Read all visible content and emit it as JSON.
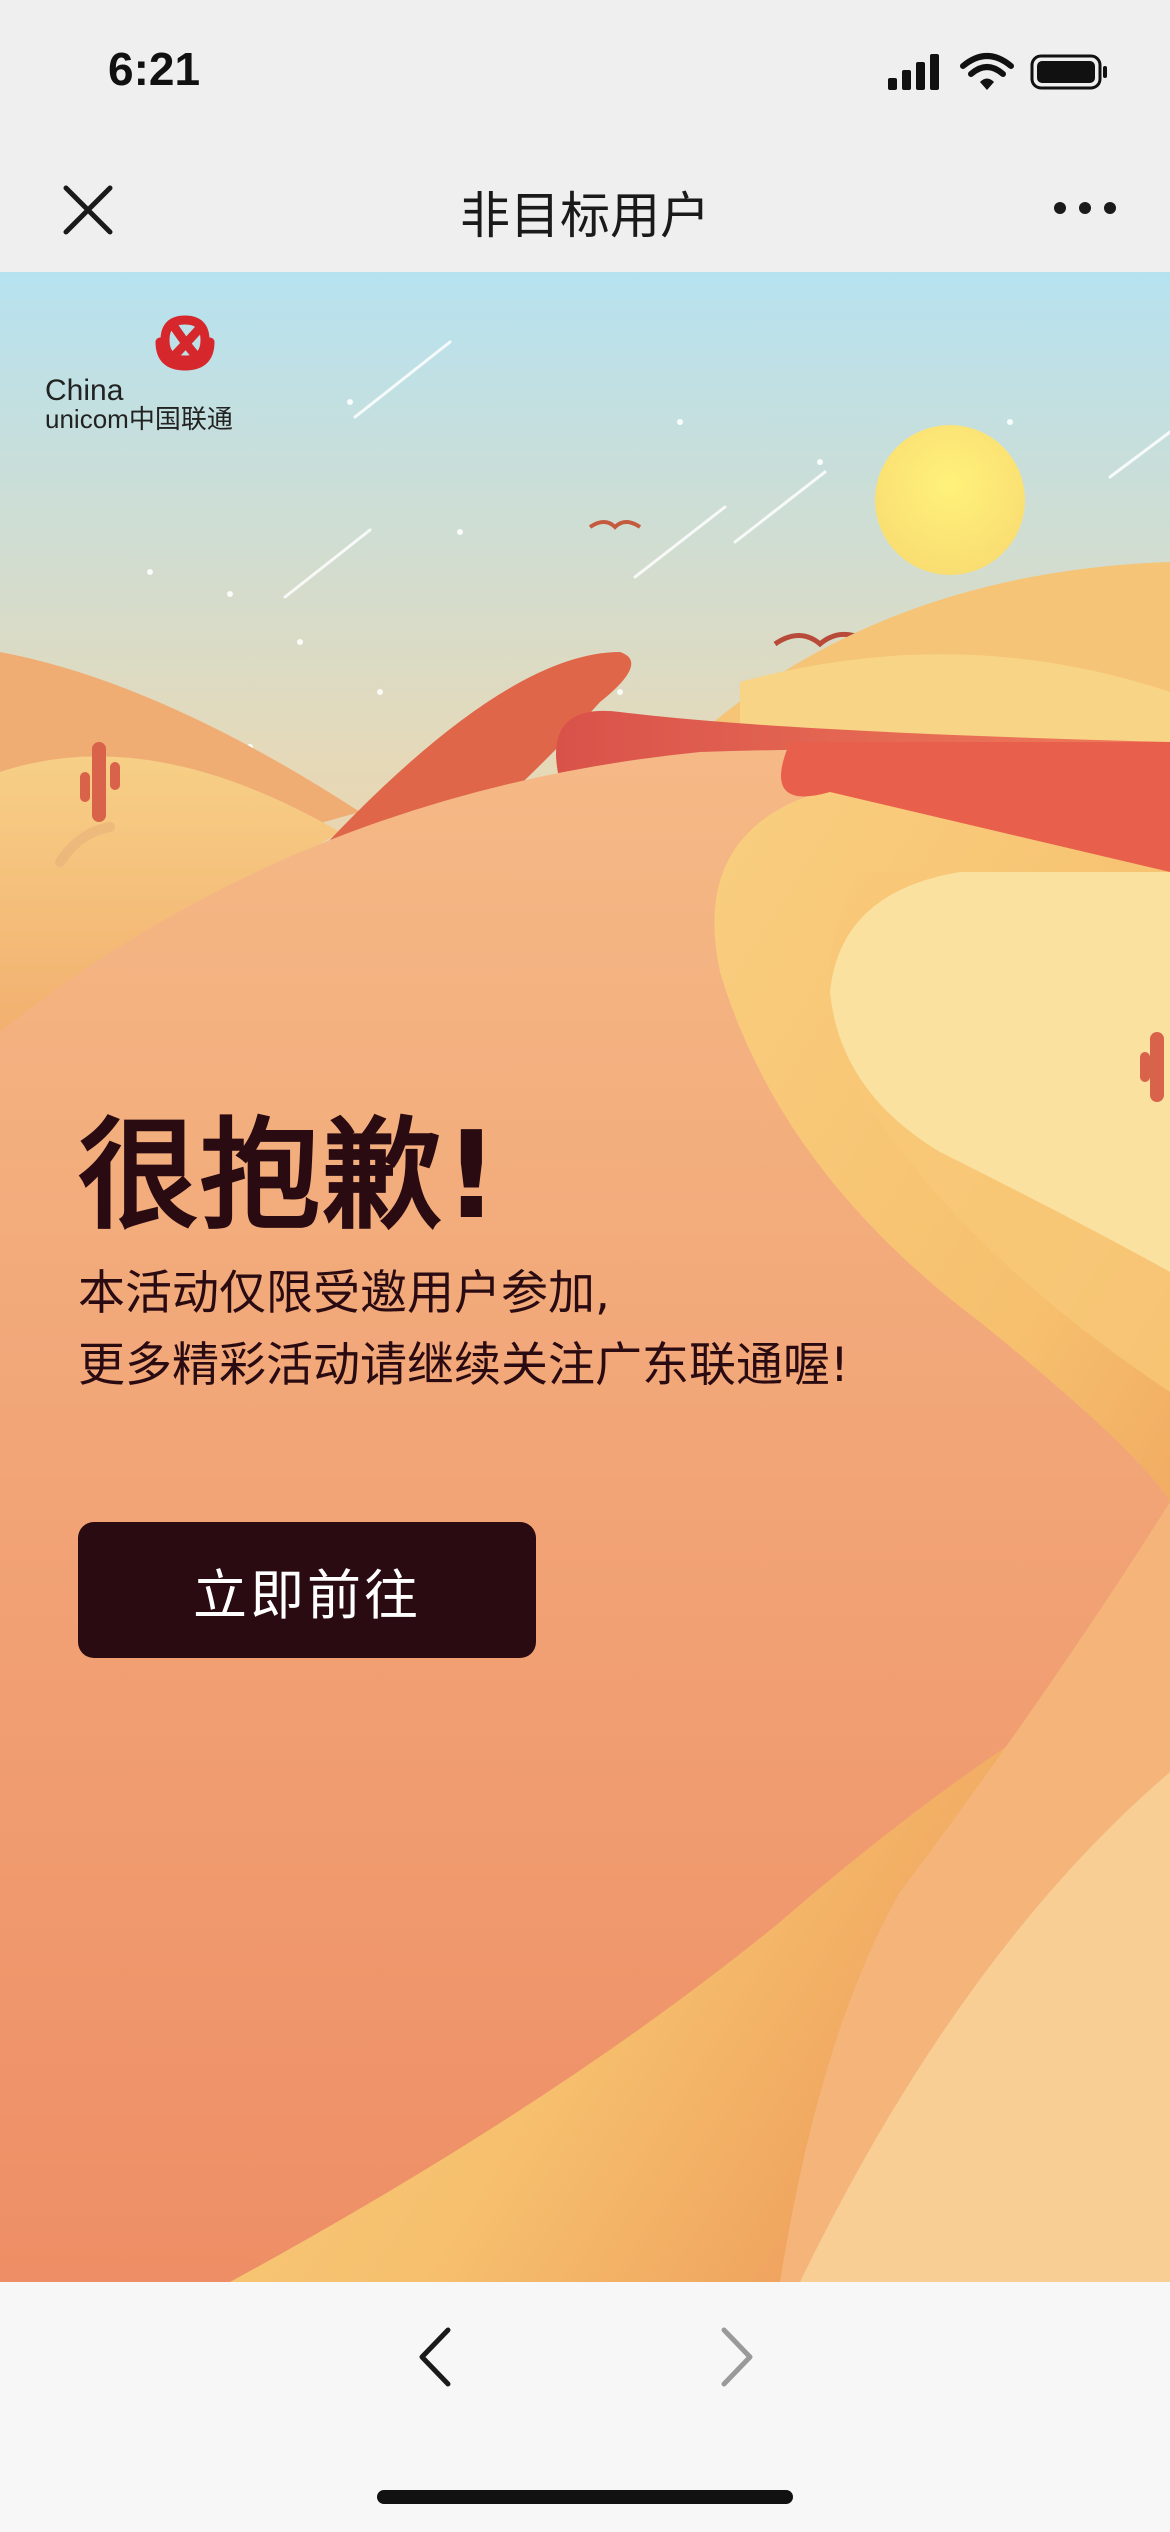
{
  "status_bar": {
    "time": "6:21",
    "icons": [
      "cellular-signal-icon",
      "wifi-icon",
      "battery-icon"
    ]
  },
  "nav": {
    "title": "非目标用户",
    "close_icon": "close-icon",
    "more_icon": "more-icon"
  },
  "brand": {
    "logo_text_line1": "China",
    "logo_text_line2": "unicom中国联通",
    "logo_color": "#d6282c"
  },
  "main": {
    "heading": "很抱歉!",
    "desc_line1": "本活动仅限受邀用户参加,",
    "desc_line2": "更多精彩活动请继续关注广东联通喔!",
    "button_label": "立即前往"
  },
  "toolbar": {
    "back_icon": "chevron-left-icon",
    "forward_icon": "chevron-right-icon"
  },
  "colors": {
    "text_dark": "#2a0b12",
    "button_bg": "#2a0b12",
    "sky_top": "#b6e2f0",
    "sand": "#f2b27e"
  }
}
